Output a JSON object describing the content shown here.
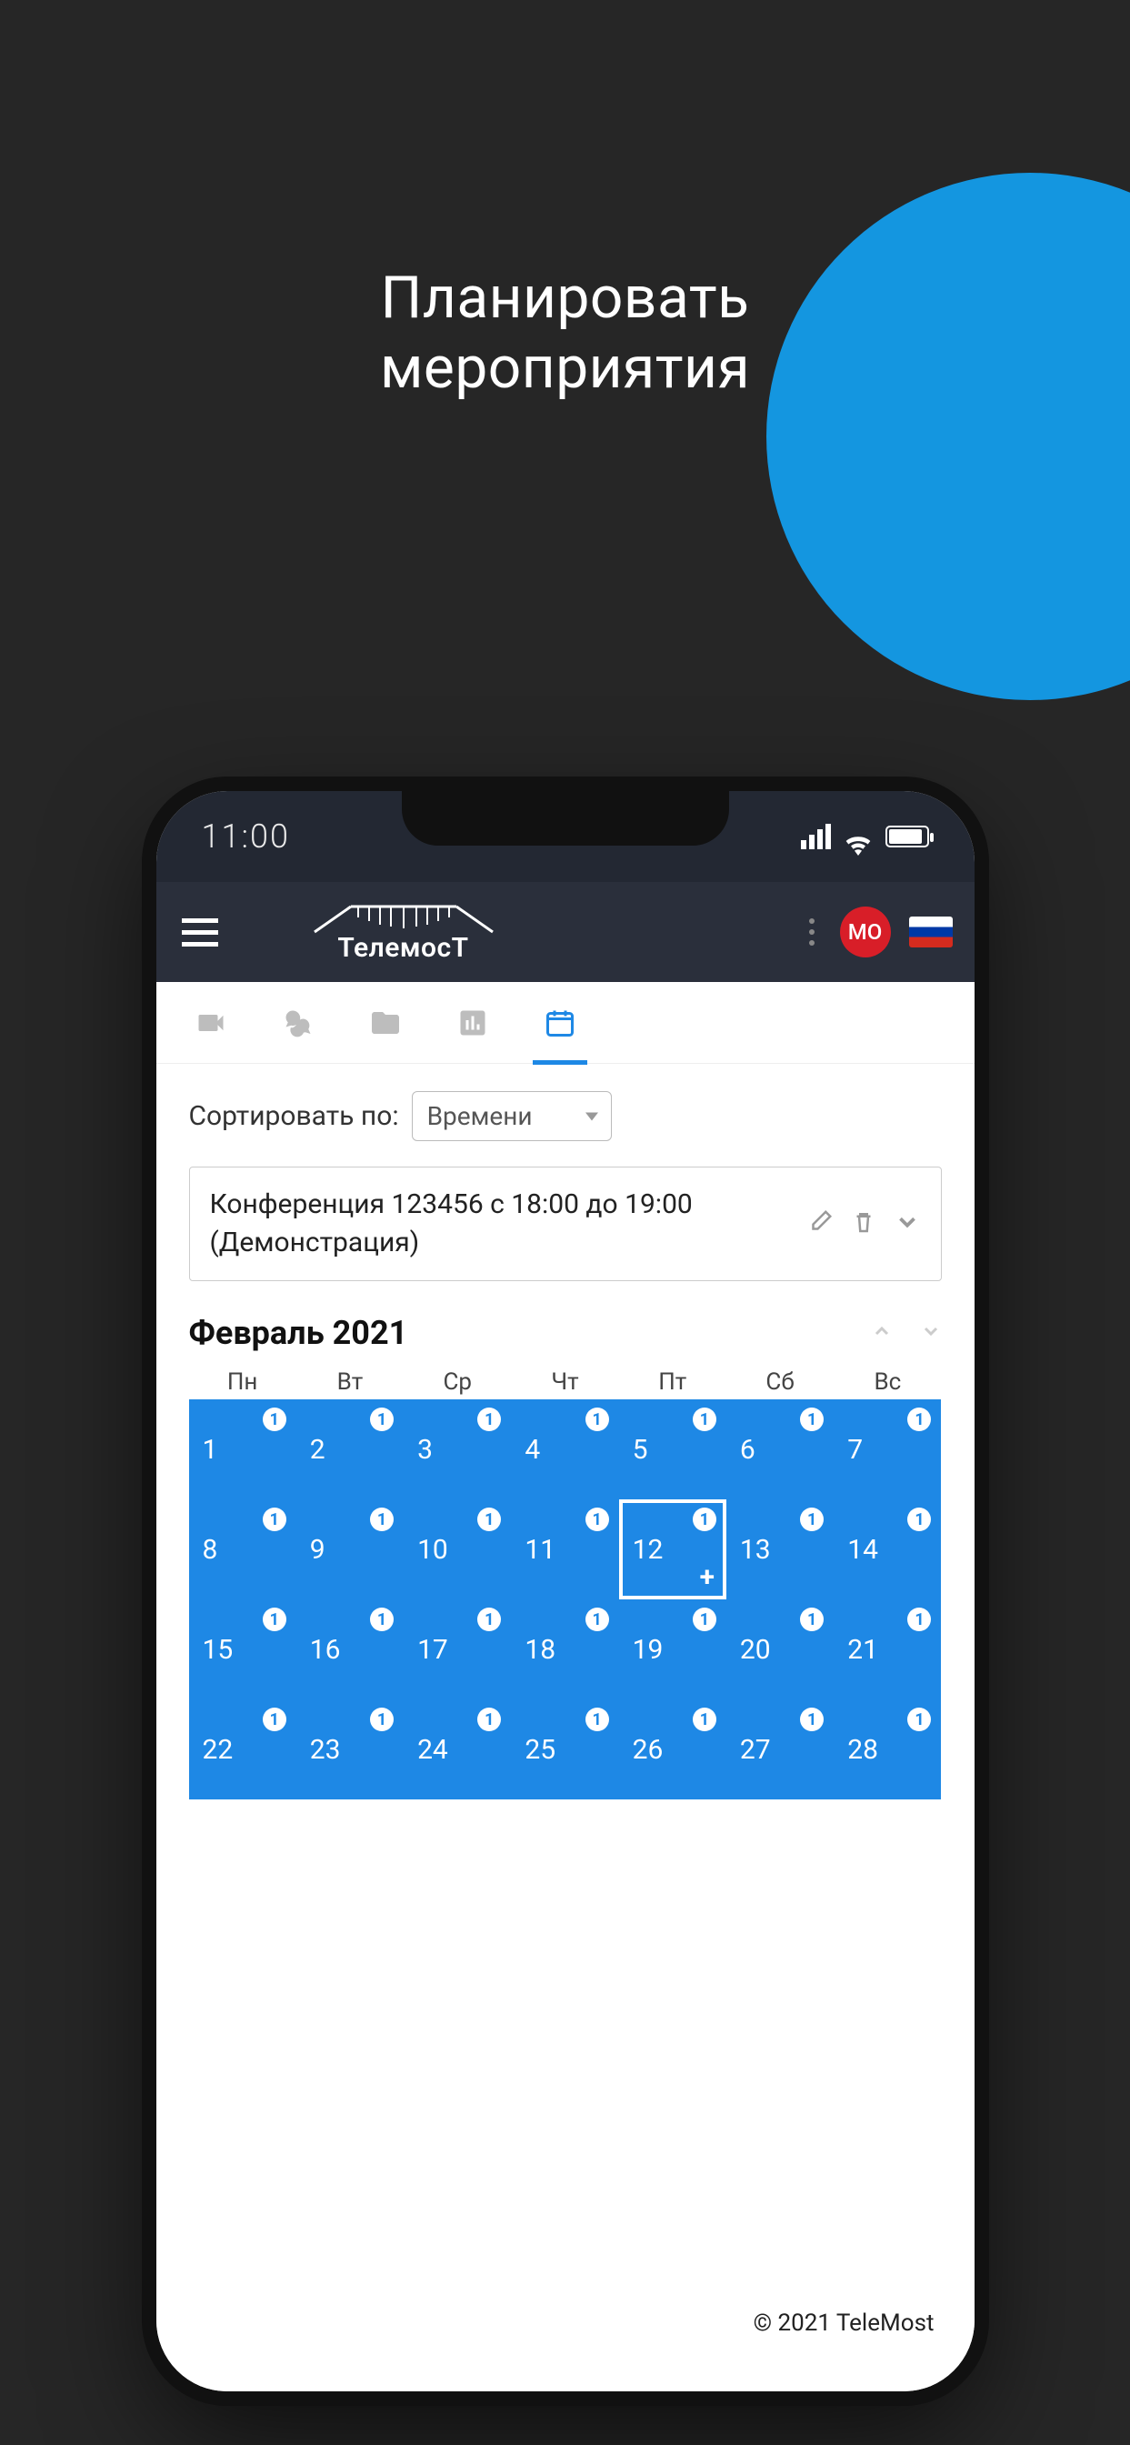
{
  "promo": {
    "line1": "Планировать",
    "line2": "мероприятия"
  },
  "statusbar": {
    "time": "11:00"
  },
  "header": {
    "brand": "ТелемосТ",
    "avatar_initials": "МО"
  },
  "sort": {
    "label": "Сортировать по:",
    "selected": "Времени"
  },
  "event": {
    "title": "Конференция 123456 с 18:00 до 19:00 (Демонстрация)"
  },
  "calendar": {
    "month_label": "Февраль 2021",
    "weekdays": [
      "Пн",
      "Вт",
      "Ср",
      "Чт",
      "Пт",
      "Сб",
      "Вс"
    ],
    "selected_day": 12,
    "badge_value": "1",
    "days": [
      1,
      2,
      3,
      4,
      5,
      6,
      7,
      8,
      9,
      10,
      11,
      12,
      13,
      14,
      15,
      16,
      17,
      18,
      19,
      20,
      21,
      22,
      23,
      24,
      25,
      26,
      27,
      28
    ]
  },
  "footer": {
    "copyright": "© 2021 TeleMost"
  },
  "colors": {
    "accent": "#1e88e5",
    "bg": "#262626",
    "circle": "#1496e0"
  }
}
